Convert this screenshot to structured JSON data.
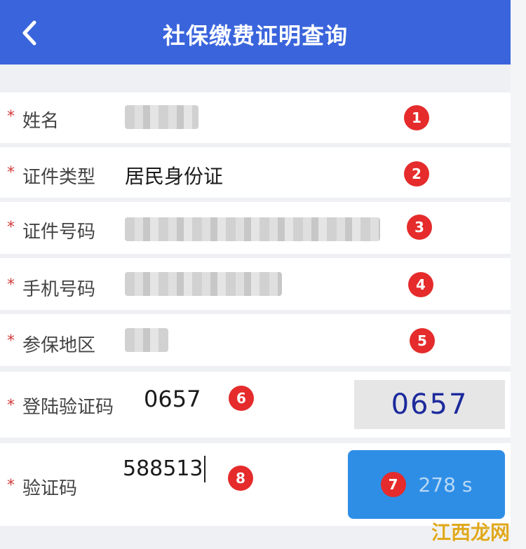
{
  "header": {
    "title": "社保缴费证明查询",
    "back_icon": "chevron-left-icon",
    "bg_color": "#3a64dc"
  },
  "form": {
    "required_mark": "*",
    "name": {
      "label": "姓名",
      "badge": "1"
    },
    "id_type": {
      "label": "证件类型",
      "value": "居民身份证",
      "badge": "2"
    },
    "id_number": {
      "label": "证件号码",
      "badge": "3"
    },
    "phone": {
      "label": "手机号码",
      "badge": "4"
    },
    "region": {
      "label": "参保地区",
      "badge": "5"
    },
    "login_captcha": {
      "label": "登陆验证码",
      "value": "0657",
      "badge": "6",
      "captcha_image_text": "0657"
    },
    "sms_code": {
      "label": "验证码",
      "value": "588513",
      "badge": "8"
    },
    "countdown_button": {
      "label": "278 s",
      "badge": "7"
    }
  },
  "watermark": "江西龙网",
  "colors": {
    "badge": "#e52b2b",
    "button": "#2e8ee6",
    "required_star": "#d23c3c"
  }
}
